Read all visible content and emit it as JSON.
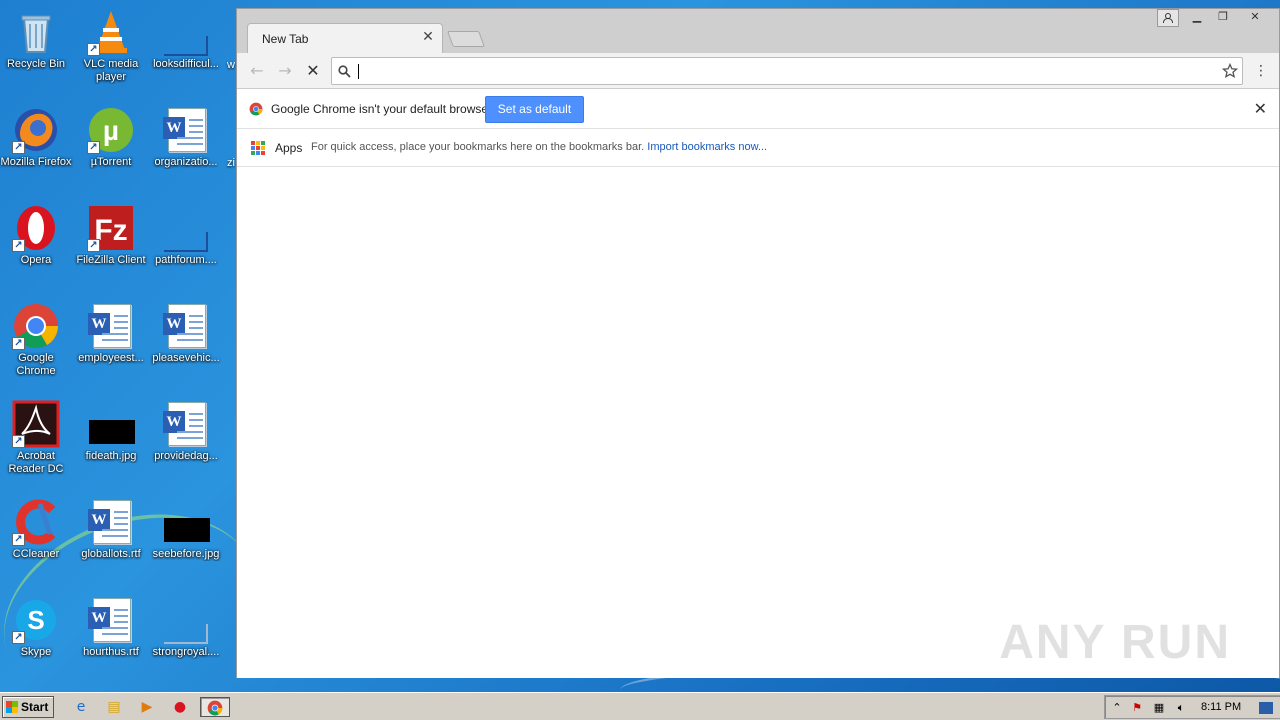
{
  "desktop": {
    "icons": [
      {
        "label": "Recycle Bin"
      },
      {
        "label": "VLC media player"
      },
      {
        "label": "looksdifficul..."
      },
      {
        "label": "Mozilla Firefox"
      },
      {
        "label": "µTorrent"
      },
      {
        "label": "organizatio..."
      },
      {
        "label": "Opera"
      },
      {
        "label": "FileZilla Client"
      },
      {
        "label": "pathforum...."
      },
      {
        "label": "Google Chrome"
      },
      {
        "label": "employeest..."
      },
      {
        "label": "pleasevehic..."
      },
      {
        "label": "Acrobat Reader DC"
      },
      {
        "label": "fideath.jpg"
      },
      {
        "label": "providedag..."
      },
      {
        "label": "CCleaner"
      },
      {
        "label": "globallots.rtf"
      },
      {
        "label": "seebefore.jpg"
      },
      {
        "label": "Skype"
      },
      {
        "label": "hourthus.rtf"
      },
      {
        "label": "strongroyal...."
      }
    ],
    "edge_labels": [
      "w",
      "zi"
    ]
  },
  "chrome": {
    "tab_title": "New Tab",
    "omnibox_value": "",
    "infobar_message": "Google Chrome isn't your default browser.",
    "set_default_label": "Set as default",
    "apps_label": "Apps",
    "bookmarks_hint": "For quick access, place your bookmarks here on the bookmarks bar.",
    "import_link": "Import bookmarks now..."
  },
  "watermark": "ANY RUN",
  "taskbar": {
    "start_label": "Start",
    "clock": "8:11 PM"
  },
  "colors": {
    "accent_button": "#4d90fe",
    "link": "#1a5ab8"
  }
}
